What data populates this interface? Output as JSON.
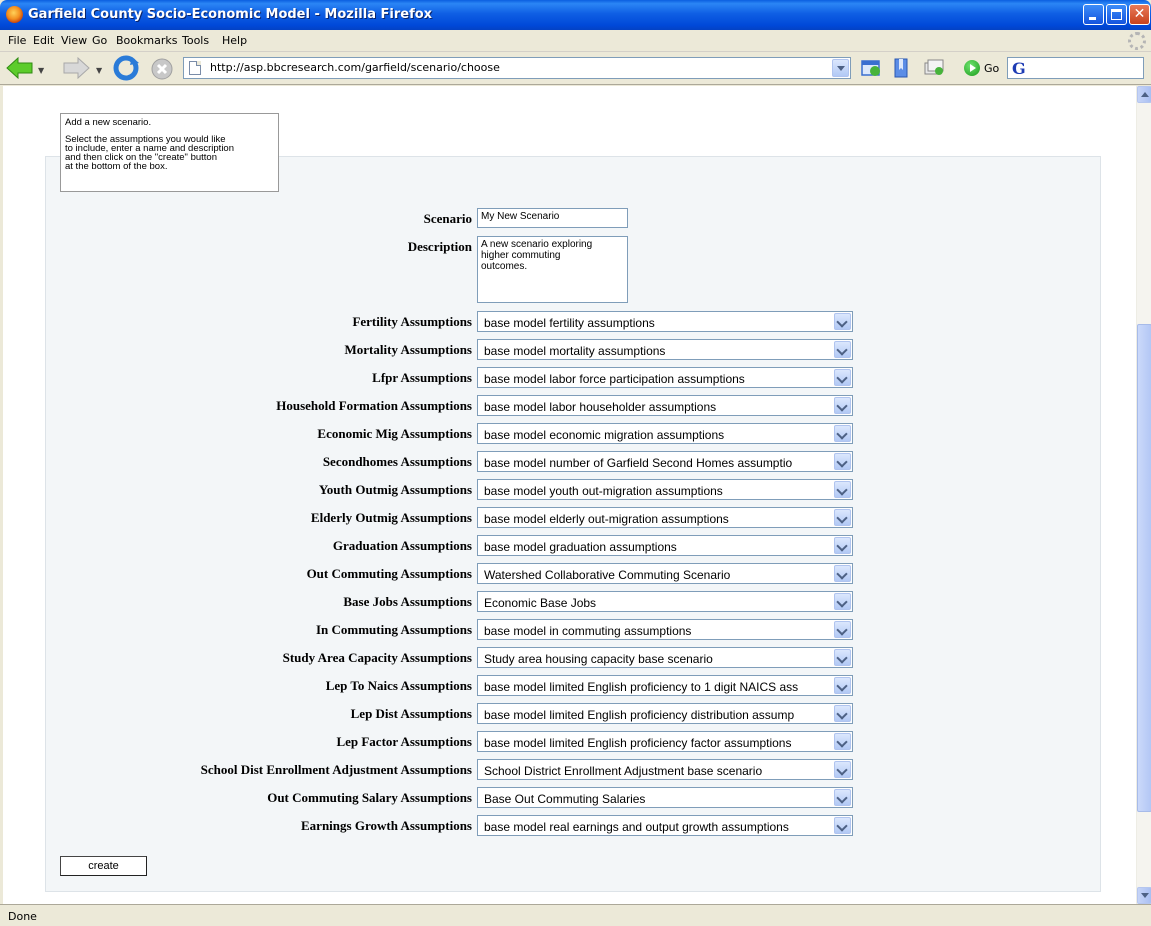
{
  "window": {
    "title": "Garfield County Socio-Economic Model - Mozilla Firefox"
  },
  "menu": [
    "File",
    "Edit",
    "View",
    "Go",
    "Bookmarks",
    "Tools",
    "Help"
  ],
  "navbar": {
    "url": "http://asp.bbcresearch.com/garfield/scenario/choose",
    "go_label": "Go",
    "search_engine_icon": "G"
  },
  "help": {
    "heading": "Add a new scenario.",
    "text": "Select the assumptions you would like\nto include, enter a name and description\nand then click on the \"create\" button\nat the bottom of the box."
  },
  "form": {
    "scenario_label": "Scenario",
    "scenario_value": "My New Scenario",
    "description_label": "Description",
    "description_value": "A new scenario exploring\nhigher commuting\noutcomes.",
    "assumptions": [
      {
        "label": "Fertility Assumptions",
        "value": "base model fertility assumptions"
      },
      {
        "label": "Mortality Assumptions",
        "value": "base model mortality assumptions"
      },
      {
        "label": "Lfpr Assumptions",
        "value": "base model labor force participation assumptions"
      },
      {
        "label": "Household Formation Assumptions",
        "value": "base model labor householder assumptions"
      },
      {
        "label": "Economic Mig Assumptions",
        "value": "base model economic migration assumptions"
      },
      {
        "label": "Secondhomes Assumptions",
        "value": "base model number of Garfield Second Homes assumptio"
      },
      {
        "label": "Youth Outmig Assumptions",
        "value": "base model youth out-migration assumptions"
      },
      {
        "label": "Elderly Outmig Assumptions",
        "value": "base model elderly out-migration assumptions"
      },
      {
        "label": "Graduation Assumptions",
        "value": "base model graduation assumptions"
      },
      {
        "label": "Out Commuting Assumptions",
        "value": "Watershed Collaborative Commuting Scenario"
      },
      {
        "label": "Base Jobs Assumptions",
        "value": "Economic Base Jobs"
      },
      {
        "label": "In Commuting Assumptions",
        "value": "base model in commuting assumptions"
      },
      {
        "label": "Study Area Capacity Assumptions",
        "value": "Study area housing capacity base scenario"
      },
      {
        "label": "Lep To Naics Assumptions",
        "value": "base model limited English proficiency to 1 digit NAICS ass"
      },
      {
        "label": "Lep Dist Assumptions",
        "value": "base model limited English proficiency distribution assump"
      },
      {
        "label": "Lep Factor Assumptions",
        "value": "base model limited English proficiency factor assumptions"
      },
      {
        "label": "School Dist Enrollment Adjustment Assumptions",
        "value": "School District Enrollment Adjustment base scenario"
      },
      {
        "label": "Out Commuting Salary Assumptions",
        "value": "Base Out Commuting Salaries"
      },
      {
        "label": "Earnings Growth Assumptions",
        "value": "base model real earnings and output growth assumptions"
      }
    ],
    "create_label": "create"
  },
  "status": "Done"
}
